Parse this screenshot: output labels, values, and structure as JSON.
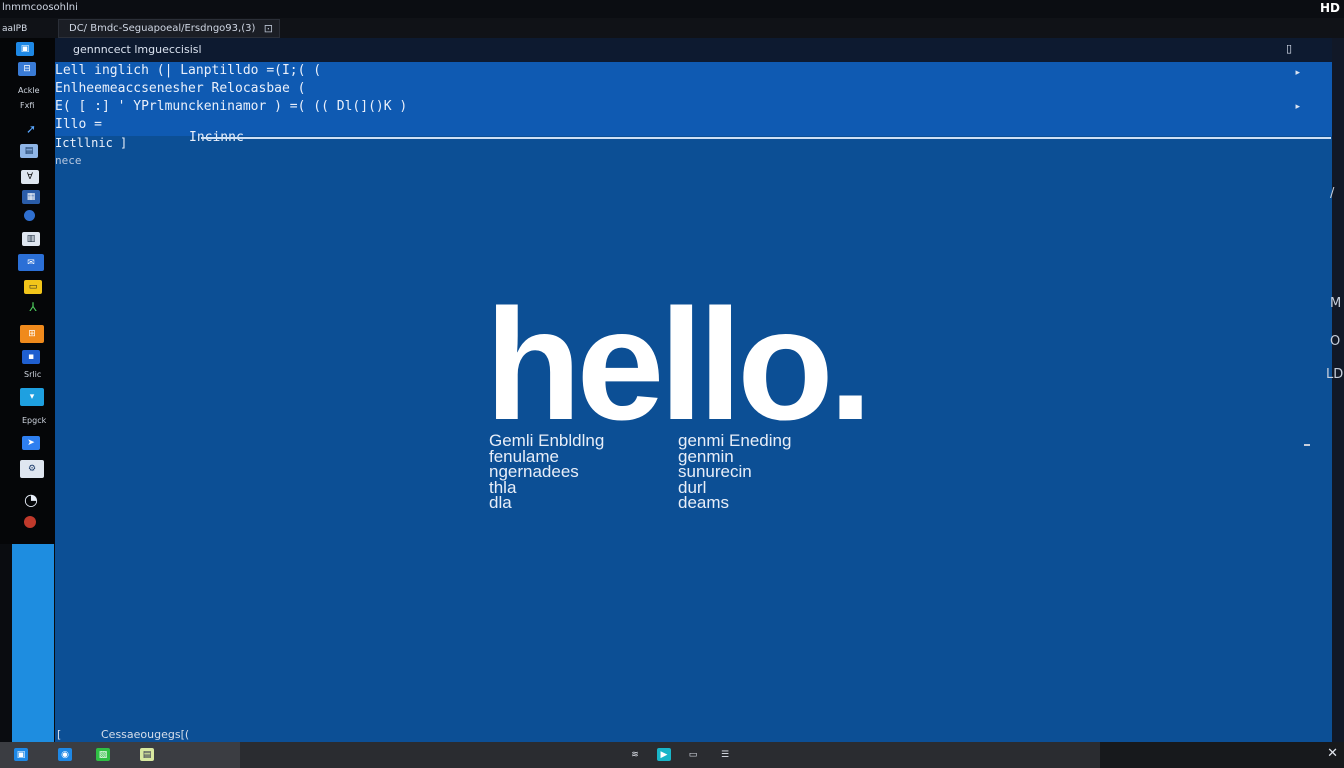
{
  "window": {
    "app_title": "lnmmcoosohlni",
    "hd_badge": "HD"
  },
  "tabs": {
    "menu_label": "aaIPB",
    "doc_tab": {
      "label": "DC/ Bmdc-Seguapoeal/Ersdngo93,(3)",
      "close": "⊡"
    }
  },
  "editor": {
    "title": "gennncect lmgueccisisl",
    "restore_icon": "▯",
    "code_lines": [
      "Lell inglich  (|  Lanptilldo =(I;( (",
      "Enlheemeaccsenesher  Relocasbae (",
      "E(  [ :]  ' YPrlmunckeninamor ) =(  (( Dl(]()K )",
      "Illo =",
      "Ictllnic ]",
      "nece"
    ],
    "inline_label": "Incinnc",
    "scroll_arrows": [
      "▸",
      "▸"
    ]
  },
  "hero": {
    "headline": "hello.",
    "left_col": [
      "Gemli Enbldlng",
      "fenulame",
      "ngernadees",
      "thla",
      "dla"
    ],
    "right_col": [
      "genmi Eneding",
      "genmin",
      "sunurecin",
      "durl",
      "deams"
    ]
  },
  "left_dock": {
    "labels": [
      "Ackle",
      "Fxfi",
      "Srlic",
      "Epgck"
    ]
  },
  "right_edge": {
    "glyphs": [
      "/",
      "M",
      "O",
      "LD"
    ]
  },
  "status": {
    "left": "[",
    "text": "Cessaeougegs[("
  },
  "colors": {
    "editor_bg": "#0c4f95",
    "code_bg": "#0f5ab2",
    "dock_accent": "#1e8de0",
    "taskbar": "#2a2c30"
  },
  "icons": [
    "window-icon",
    "folder-icon",
    "pin-icon",
    "terminal-icon",
    "vs-icon",
    "grid-icon",
    "dot-icon",
    "panel-icon",
    "mail-icon",
    "note-icon",
    "tree-icon",
    "warning-icon",
    "square-icon",
    "chat-icon",
    "send-icon",
    "gear-icon",
    "clock-icon",
    "user-icon"
  ]
}
